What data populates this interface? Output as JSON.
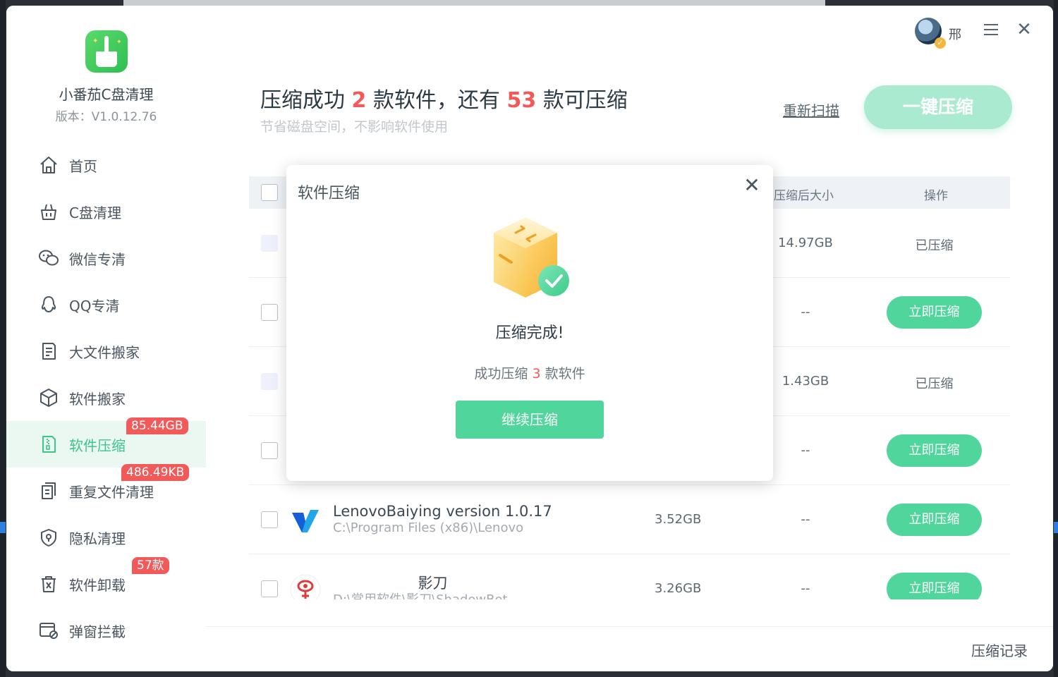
{
  "app": {
    "name": "小番茄C盘清理",
    "version": "版本：V1.0.12.76"
  },
  "sidebar": {
    "items": [
      {
        "label": "首页",
        "icon": "home-icon"
      },
      {
        "label": "C盘清理",
        "icon": "basket-icon"
      },
      {
        "label": "微信专清",
        "icon": "wechat-icon"
      },
      {
        "label": "QQ专清",
        "icon": "qq-icon"
      },
      {
        "label": "大文件搬家",
        "icon": "file-move-icon"
      },
      {
        "label": "软件搬家",
        "icon": "box-move-icon"
      },
      {
        "label": "软件压缩",
        "icon": "zip-icon",
        "active": true,
        "badge": "85.44GB"
      },
      {
        "label": "重复文件清理",
        "icon": "duplicate-icon",
        "badge": "486.49KB"
      },
      {
        "label": "隐私清理",
        "icon": "shield-icon"
      },
      {
        "label": "软件卸载",
        "icon": "uninstall-icon",
        "badge": "57款"
      },
      {
        "label": "弹窗拦截",
        "icon": "popup-block-icon"
      }
    ]
  },
  "user": {
    "name": "邢"
  },
  "header": {
    "headline_prefix": "压缩成功",
    "headline_count1": "2",
    "headline_mid": "款软件，还有",
    "headline_count2": "53",
    "headline_suffix": "款可压缩",
    "subline": "节省磁盘空间，不影响软件使用",
    "rescan_label": "重新扫描",
    "onekey_label": "一键压缩"
  },
  "table": {
    "columns": {
      "after_size": "压缩后大小",
      "operation": "操作"
    },
    "rows": [
      {
        "name": "",
        "path": "",
        "size": "",
        "after": "14.97GB",
        "op": "已压缩",
        "op_is_button": false,
        "disabled": true
      },
      {
        "name": "",
        "path": "",
        "size": "",
        "after": "--",
        "op": "立即压缩",
        "op_is_button": true,
        "disabled": false
      },
      {
        "name": "",
        "path": "",
        "size": "",
        "after": "1.43GB",
        "op": "已压缩",
        "op_is_button": false,
        "disabled": true
      },
      {
        "name": "",
        "path": "",
        "size": "",
        "after": "--",
        "op": "立即压缩",
        "op_is_button": true,
        "disabled": false
      },
      {
        "name": "LenovoBaiying version 1.0.17",
        "path": "C:\\Program Files (x86)\\Lenovo",
        "size": "3.52GB",
        "after": "--",
        "op": "立即压缩",
        "op_is_button": true,
        "disabled": false
      },
      {
        "name": "影刀",
        "path": "D:\\常用软件\\影刀\\ShadowBot",
        "size": "3.26GB",
        "after": "--",
        "op": "立即压缩",
        "op_is_button": true,
        "disabled": false
      }
    ]
  },
  "footer": {
    "history_label": "压缩记录"
  },
  "modal": {
    "title": "软件压缩",
    "heading": "压缩完成!",
    "sub_prefix": "成功压缩",
    "sub_count": "3",
    "sub_suffix": "款软件",
    "button_label": "继续压缩"
  },
  "colors": {
    "accent_green": "#50d69c",
    "badge_red": "#f25a5a",
    "onekey_disabled": "#a9ead0"
  }
}
